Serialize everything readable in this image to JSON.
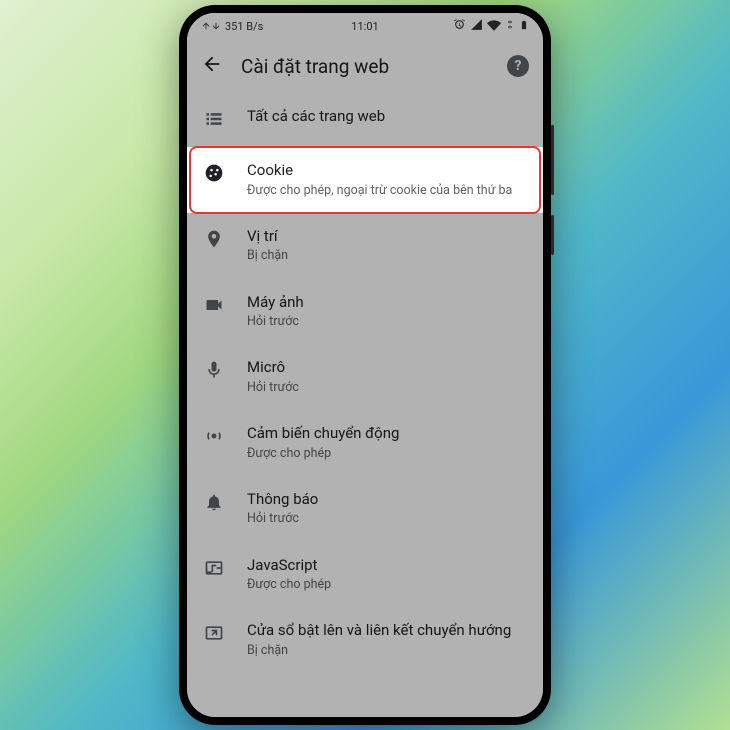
{
  "status": {
    "speed": "351 B/s",
    "time": "11:01"
  },
  "header": {
    "title": "Cài đặt trang web"
  },
  "items": [
    {
      "title": "Tất cả các trang web",
      "subtitle": "",
      "icon": "list",
      "highlight": false
    },
    {
      "title": "Cookie",
      "subtitle": "Được cho phép, ngoại trừ cookie của bên thứ ba",
      "icon": "cookie",
      "highlight": true
    },
    {
      "title": "Vị trí",
      "subtitle": "Bị chặn",
      "icon": "location",
      "highlight": false
    },
    {
      "title": "Máy ảnh",
      "subtitle": "Hỏi trước",
      "icon": "camera",
      "highlight": false
    },
    {
      "title": "Micrô",
      "subtitle": "Hỏi trước",
      "icon": "mic",
      "highlight": false
    },
    {
      "title": "Cảm biến chuyển động",
      "subtitle": "Được cho phép",
      "icon": "motion",
      "highlight": false
    },
    {
      "title": "Thông báo",
      "subtitle": "Hỏi trước",
      "icon": "bell",
      "highlight": false
    },
    {
      "title": "JavaScript",
      "subtitle": "Được cho phép",
      "icon": "js",
      "highlight": false
    },
    {
      "title": "Cửa sổ bật lên và liên kết chuyển hướng",
      "subtitle": "Bị chặn",
      "icon": "popup",
      "highlight": false
    }
  ]
}
